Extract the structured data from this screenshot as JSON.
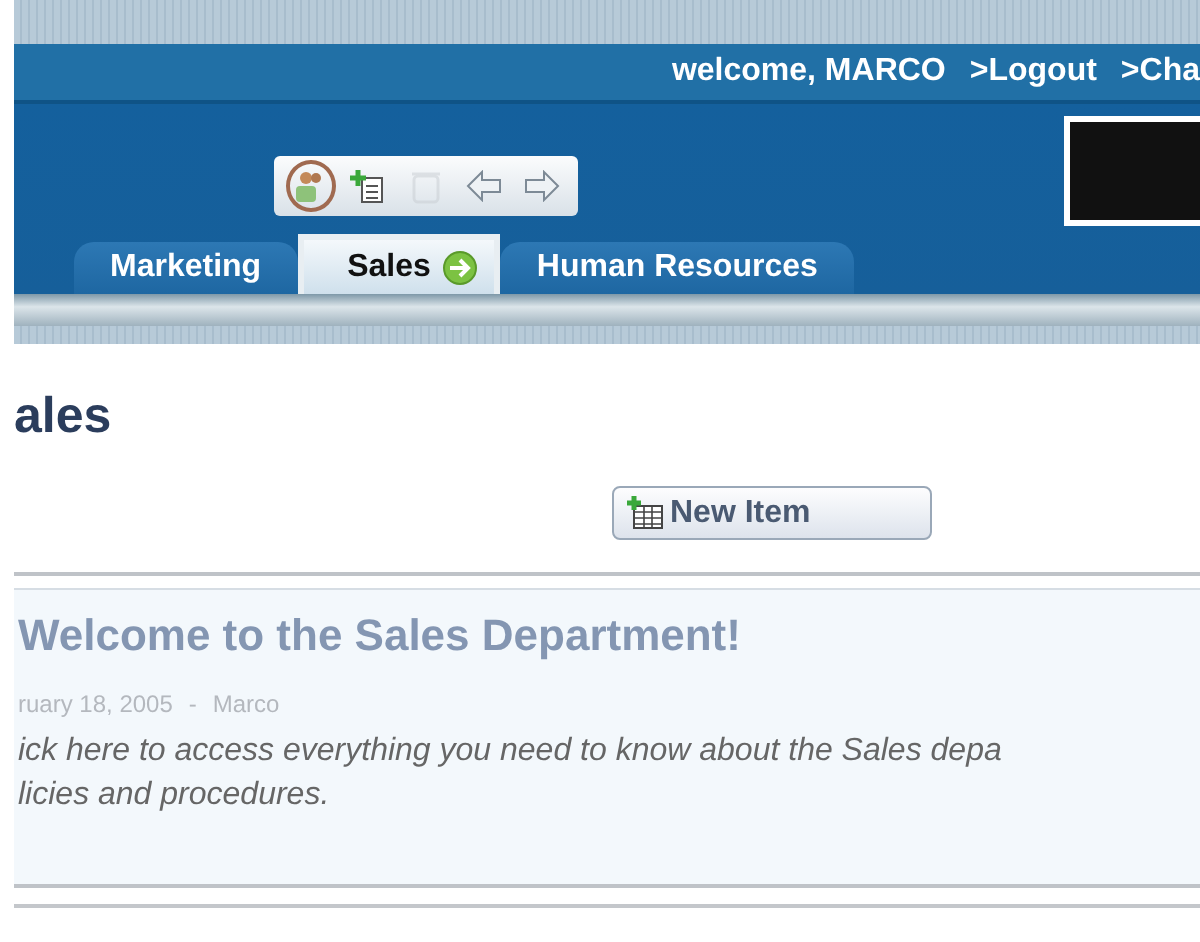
{
  "header": {
    "welcome": "welcome, MARCO",
    "links": [
      ">Logout",
      ">Cha"
    ]
  },
  "toolbar": {
    "buttons": [
      {
        "kind": "people",
        "disabled": false,
        "circled": true
      },
      {
        "kind": "new-page",
        "disabled": false,
        "circled": false
      },
      {
        "kind": "trash",
        "disabled": true,
        "circled": false
      },
      {
        "kind": "back",
        "disabled": false,
        "circled": false
      },
      {
        "kind": "forward",
        "disabled": false,
        "circled": false
      }
    ]
  },
  "tabs": [
    {
      "label": "Marketing",
      "selected": false
    },
    {
      "label": "Sales",
      "selected": true
    },
    {
      "label": "Human Resources",
      "selected": false
    }
  ],
  "page_title": "ales",
  "new_item_button": "New Item",
  "announcement": {
    "title": "Welcome to the Sales Department!",
    "date": "ruary 18, 2005",
    "separator": "-",
    "author": "Marco",
    "body": [
      "ick here to access everything you need to know about the Sales depa",
      "licies and procedures."
    ]
  }
}
